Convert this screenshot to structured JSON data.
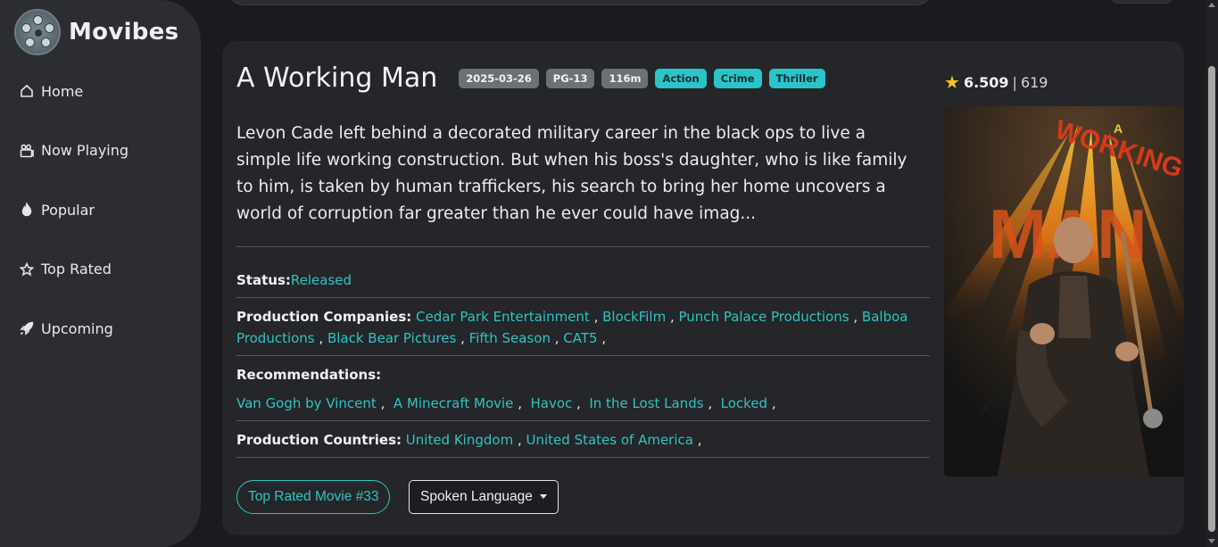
{
  "brand": {
    "name": "Movibes"
  },
  "sidebar": {
    "items": [
      {
        "label": "Home",
        "icon": "home-icon"
      },
      {
        "label": "Now Playing",
        "icon": "film-icon"
      },
      {
        "label": "Popular",
        "icon": "fire-icon"
      },
      {
        "label": "Top Rated",
        "icon": "star-icon"
      },
      {
        "label": "Upcoming",
        "icon": "rocket-icon"
      }
    ]
  },
  "movie": {
    "title": "A Working Man",
    "release_date": "2025-03-26",
    "certification": "PG-13",
    "runtime": "116m",
    "genres": [
      "Action",
      "Crime",
      "Thriller"
    ],
    "overview": "Levon Cade left behind a decorated military career in the black ops to live a simple life working construction. But when his boss's daughter, who is like family to him, is taken by human traffickers, his search to bring her home uncovers a world of corruption far greater than he ever could have imag...",
    "status_label": "Status:",
    "status": "Released",
    "companies_label": "Production Companies:",
    "companies": [
      "Cedar Park Entertainment",
      "BlockFilm",
      "Punch Palace Productions",
      "Balboa Productions",
      "Black Bear Pictures",
      "Fifth Season",
      "CAT5"
    ],
    "recommendations_label": "Recommendations:",
    "recommendations": [
      "Van Gogh by Vincent",
      "A Minecraft Movie",
      "Havoc",
      "In the Lost Lands",
      "Locked"
    ],
    "countries_label": "Production Countries:",
    "countries": [
      "United Kingdom",
      "United States of America"
    ],
    "rank_button": "Top Rated Movie #33",
    "language_button": "Spoken Language",
    "rating": "6.509",
    "votes": "619",
    "poster_text_small": "A",
    "poster_text_big": "WORKING",
    "poster_text_man": "MAN"
  },
  "colors": {
    "accent": "#30c4c2",
    "badge_gray": "#6b7178",
    "badge_cyan": "#2bc4c8",
    "star": "#f7c21b",
    "background": "#1a1b1e",
    "card": "#24262a",
    "sidebar": "#2c2d30"
  }
}
